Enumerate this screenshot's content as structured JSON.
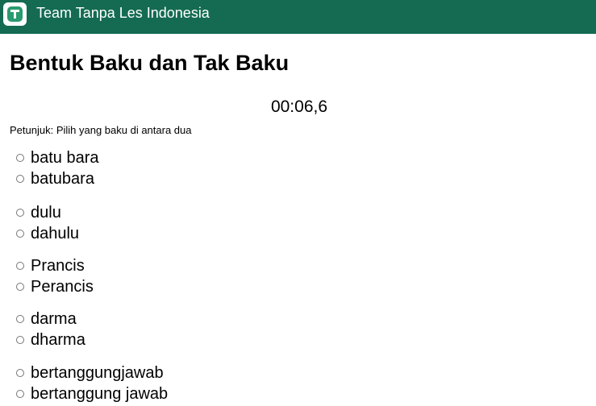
{
  "header": {
    "app_title": "Team Tanpa Les Indonesia",
    "brand_color": "#146b52",
    "logo_icon": "t-logo-icon"
  },
  "main": {
    "title": "Bentuk Baku dan Tak Baku",
    "timer": "00:06,6",
    "instruction": "Petunjuk: Pilih yang baku di antara dua",
    "questions": [
      {
        "options": [
          "batu bara",
          "batubara"
        ]
      },
      {
        "options": [
          "dulu",
          "dahulu"
        ]
      },
      {
        "options": [
          "Prancis",
          "Perancis"
        ]
      },
      {
        "options": [
          "darma",
          "dharma"
        ]
      },
      {
        "options": [
          "bertanggungjawab",
          "bertanggung jawab"
        ]
      }
    ]
  }
}
